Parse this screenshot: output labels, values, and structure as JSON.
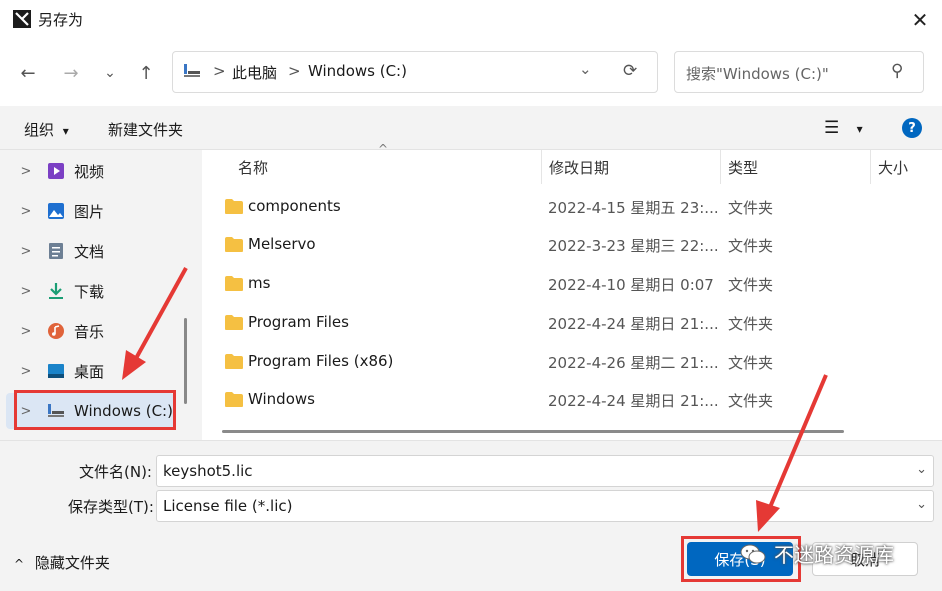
{
  "window": {
    "title": "另存为",
    "close_glyph": "✕"
  },
  "nav": {
    "back_glyph": "←",
    "forward_glyph": "→",
    "recent_glyph": "⌄",
    "up_glyph": "↑",
    "breadcrumb": [
      "此电脑",
      "Windows (C:)"
    ],
    "separator": ">",
    "refresh_glyph": "⟳",
    "dropdown_glyph": "⌄",
    "search_placeholder": "搜索\"Windows (C:)\"",
    "search_glyph": "⚲"
  },
  "toolbar": {
    "organize": "组织",
    "organize_caret": "▾",
    "new_folder": "新建文件夹",
    "view_glyph": "☰",
    "view_caret": "▾",
    "help_glyph": "?"
  },
  "sidebar": {
    "chevron": ">",
    "items": [
      {
        "label": "视频",
        "icon": "video-icon"
      },
      {
        "label": "图片",
        "icon": "pictures-icon"
      },
      {
        "label": "文档",
        "icon": "documents-icon"
      },
      {
        "label": "下载",
        "icon": "download-icon"
      },
      {
        "label": "音乐",
        "icon": "music-icon"
      },
      {
        "label": "桌面",
        "icon": "desktop-icon"
      },
      {
        "label": "Windows (C:)",
        "icon": "drive-icon",
        "selected": true
      }
    ]
  },
  "filelist": {
    "sort_caret": "^",
    "columns": {
      "name": "名称",
      "date": "修改日期",
      "type": "类型",
      "size": "大小"
    },
    "rows": [
      {
        "name": "components",
        "date": "2022-4-15 星期五 23:...",
        "type": "文件夹"
      },
      {
        "name": "Melservo",
        "date": "2022-3-23 星期三 22:...",
        "type": "文件夹"
      },
      {
        "name": "ms",
        "date": "2022-4-10 星期日 0:07",
        "type": "文件夹"
      },
      {
        "name": "Program Files",
        "date": "2022-4-24 星期日 21:...",
        "type": "文件夹"
      },
      {
        "name": "Program Files (x86)",
        "date": "2022-4-26 星期二 21:...",
        "type": "文件夹"
      },
      {
        "name": "Windows",
        "date": "2022-4-24 星期日 21:...",
        "type": "文件夹"
      }
    ]
  },
  "form": {
    "filename_label": "文件名(N):",
    "filename_value": "keyshot5.lic",
    "filetype_label": "保存类型(T):",
    "filetype_value": "License file (*.lic)",
    "dropdown_glyph": "⌄"
  },
  "footer": {
    "hide_folders_caret": "^",
    "hide_folders": "隐藏文件夹",
    "save": "保存(S)",
    "cancel": "取消"
  },
  "watermark": "不迷路资源库",
  "colors": {
    "annotation_red": "#e53935",
    "selection_blue": "#dbe6f4",
    "accent": "#0067c0",
    "folder": "#f5c042"
  }
}
